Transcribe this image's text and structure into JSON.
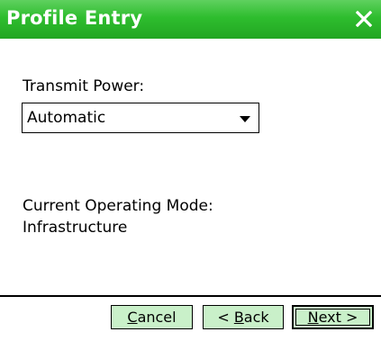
{
  "window": {
    "title": "Profile Entry",
    "close_icon": "close-icon"
  },
  "form": {
    "transmit_power_label": "Transmit Power:",
    "transmit_power_value": "Automatic",
    "operating_mode_label": "Current Operating Mode:",
    "operating_mode_value": "Infrastructure"
  },
  "buttons": {
    "cancel": {
      "mnemonic": "C",
      "rest": "ancel"
    },
    "back": {
      "prefix": "< ",
      "mnemonic": "B",
      "rest": "ack"
    },
    "next": {
      "mnemonic": "N",
      "rest": "ext >"
    }
  },
  "colors": {
    "titlebar": "#2ebd2e",
    "button_face": "#c9f0c9"
  }
}
